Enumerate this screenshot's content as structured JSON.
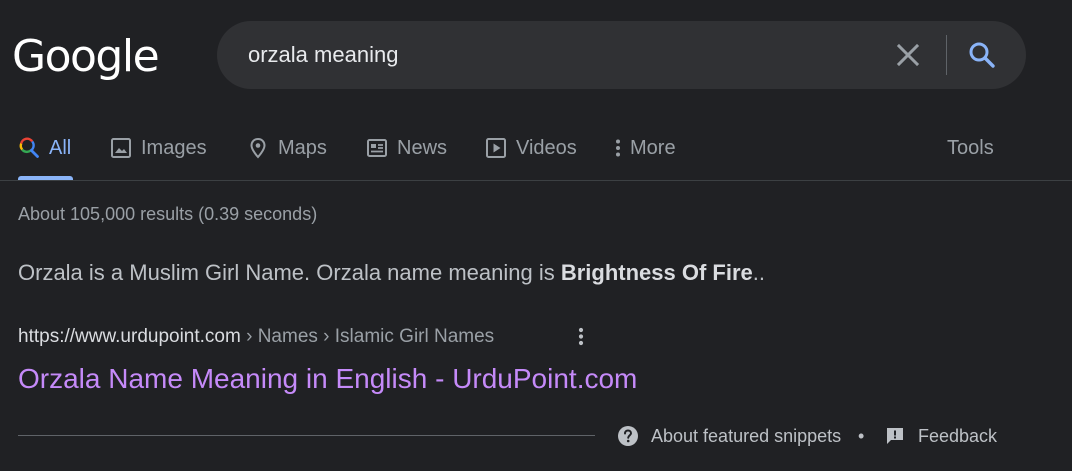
{
  "logo": {
    "text": "Google"
  },
  "search": {
    "value": "orzala meaning",
    "clear_icon": "close-icon",
    "search_icon": "search-icon"
  },
  "tabs": [
    {
      "label": "All",
      "icon": "search-multicolor-icon",
      "active": true
    },
    {
      "label": "Images",
      "icon": "image-icon"
    },
    {
      "label": "Maps",
      "icon": "map-pin-icon"
    },
    {
      "label": "News",
      "icon": "news-icon"
    },
    {
      "label": "Videos",
      "icon": "video-icon"
    },
    {
      "label": "More",
      "icon": "more-vert-icon"
    }
  ],
  "tools_label": "Tools",
  "stats": "About 105,000 results (0.39 seconds)",
  "snippet": {
    "text": "Orzala is a Muslim Girl Name. Orzala name meaning is ",
    "bold": "Brightness Of Fire",
    "suffix": ".."
  },
  "result": {
    "url": "https://www.urdupoint.com",
    "breadcrumbs": " › Names › Islamic Girl Names",
    "title": "Orzala Name Meaning in English - UrduPoint.com"
  },
  "footer": {
    "about_snippets": "About featured snippets",
    "separator": "•",
    "feedback": "Feedback"
  },
  "colors": {
    "background": "#202124",
    "link_visited": "#c58af9",
    "accent": "#8ab4f8"
  }
}
